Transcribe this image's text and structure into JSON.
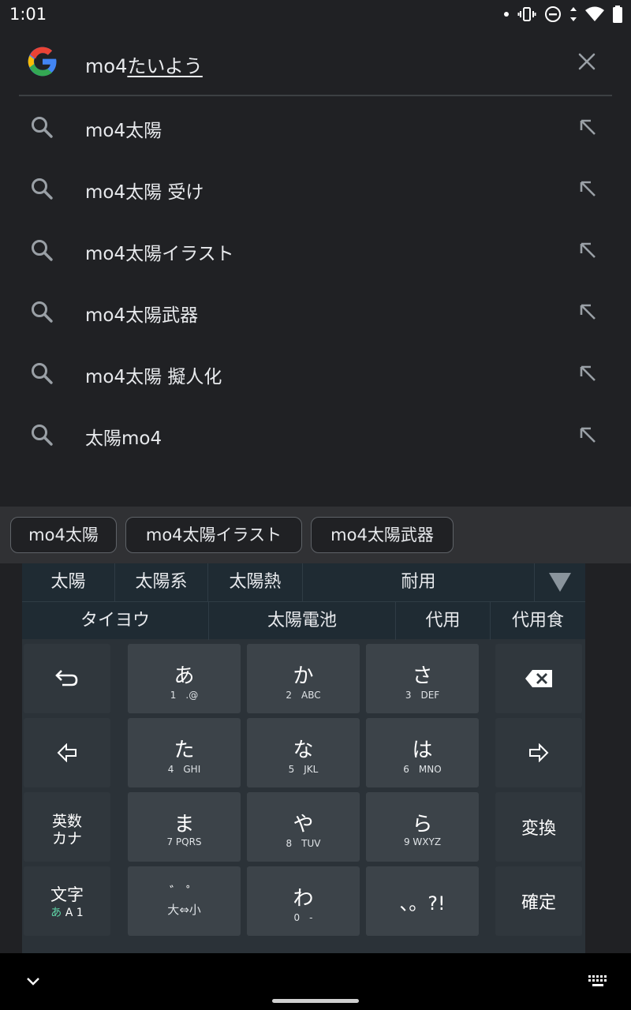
{
  "status": {
    "time": "1:01",
    "icons": [
      "dot-icon",
      "vibrate-icon",
      "dnd-icon",
      "data-arrows-icon",
      "wifi-icon",
      "battery-icon"
    ]
  },
  "search": {
    "query_latin": "mo4",
    "query_composing": "たいよう"
  },
  "suggestions": [
    {
      "text": "mo4太陽"
    },
    {
      "text": "mo4太陽 受け"
    },
    {
      "text": "mo4太陽イラスト"
    },
    {
      "text": "mo4太陽武器"
    },
    {
      "text": "mo4太陽 擬人化"
    },
    {
      "text": "太陽mo4"
    }
  ],
  "chips": [
    "mo4太陽",
    "mo4太陽イラスト",
    "mo4太陽武器"
  ],
  "keyboard": {
    "candidates_row1": [
      "太陽",
      "太陽系",
      "太陽熱",
      "耐用"
    ],
    "candidates_row2": [
      "タイヨウ",
      "太陽電池",
      "代用",
      "代用食"
    ],
    "keys": {
      "a": {
        "main": "あ",
        "sub": "1　.@"
      },
      "ka": {
        "main": "か",
        "sub": "2　ABC"
      },
      "sa": {
        "main": "さ",
        "sub": "3　DEF"
      },
      "ta": {
        "main": "た",
        "sub": "4　GHI"
      },
      "na": {
        "main": "な",
        "sub": "5　JKL"
      },
      "ha": {
        "main": "は",
        "sub": "6　MNO"
      },
      "ma": {
        "main": "ま",
        "sub": "7 PQRS"
      },
      "ya": {
        "main": "や",
        "sub": "8　TUV"
      },
      "ra": {
        "main": "ら",
        "sub": "9 WXYZ"
      },
      "dakuten": {
        "main": "゛ ゜",
        "sub": "大⇔小"
      },
      "wa": {
        "main": "わ",
        "sub": "0　-"
      },
      "punct": "、。?!",
      "eisu_line1": "英数",
      "eisu_line2": "カナ",
      "moji_line1": "文字",
      "moji_hira": "あ",
      "moji_rest": "A 1",
      "henkan": "変換",
      "kakutei": "確定"
    }
  },
  "colors": {
    "background": "#202124",
    "chip_row": "#303134",
    "candidate_bg": "#1f2b33",
    "key": "#3c4349",
    "fn_key": "#30373d",
    "moji_hira_accent": "#5fd3a6"
  }
}
